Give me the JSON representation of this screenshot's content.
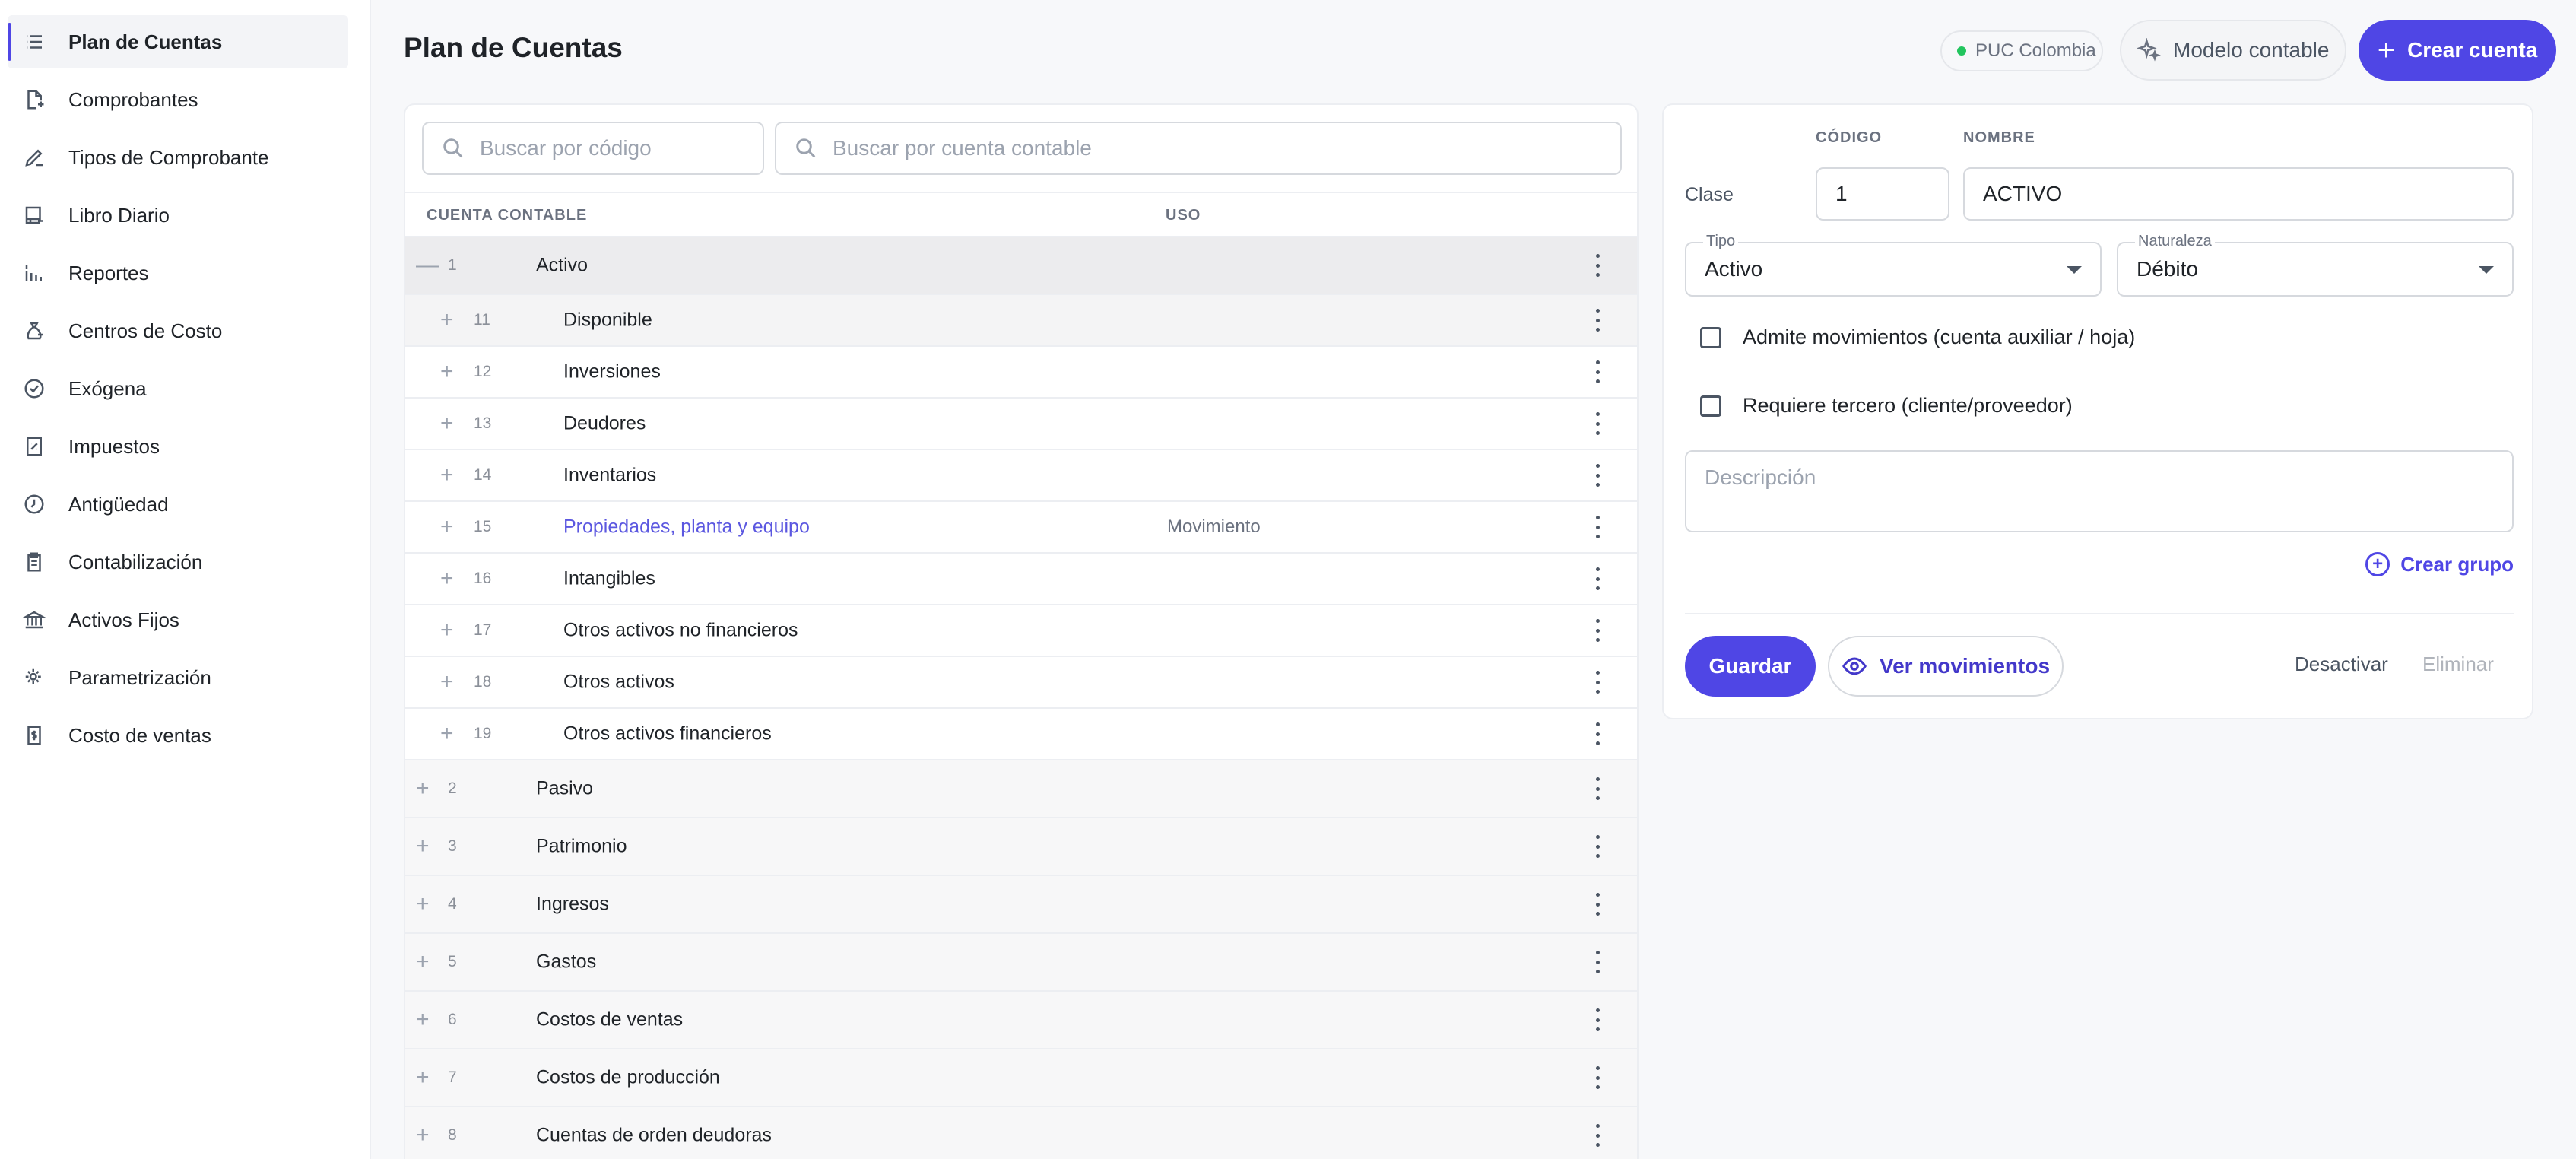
{
  "sidebar": {
    "items": [
      {
        "label": "Plan de Cuentas",
        "icon": "list-icon"
      },
      {
        "label": "Comprobantes",
        "icon": "document-icon"
      },
      {
        "label": "Tipos de Comprobante",
        "icon": "pen-icon"
      },
      {
        "label": "Libro Diario",
        "icon": "book-icon"
      },
      {
        "label": "Reportes",
        "icon": "bar-chart-icon"
      },
      {
        "label": "Centros de Costo",
        "icon": "money-bag-icon"
      },
      {
        "label": "Exógena",
        "icon": "check-circle-icon"
      },
      {
        "label": "Impuestos",
        "icon": "receipt-percent-icon"
      },
      {
        "label": "Antigüedad",
        "icon": "clock-icon"
      },
      {
        "label": "Contabilización",
        "icon": "clipboard-icon"
      },
      {
        "label": "Activos Fijos",
        "icon": "bank-icon"
      },
      {
        "label": "Parametrización",
        "icon": "settings-icon"
      },
      {
        "label": "Costo de ventas",
        "icon": "receipt-dollar-icon"
      }
    ]
  },
  "header": {
    "title": "Plan de Cuentas",
    "puc_badge": "PUC Colombia",
    "modelo_label": "Modelo contable",
    "crear_cuenta_label": "Crear cuenta"
  },
  "tree": {
    "search_code_placeholder": "Buscar por código",
    "search_account_placeholder": "Buscar por cuenta contable",
    "col_cuenta": "CUENTA CONTABLE",
    "col_uso": "USO",
    "rows": [
      {
        "level": 1,
        "toggle": "—",
        "code": "1",
        "name": "Activo",
        "uso": ""
      },
      {
        "level": 2,
        "toggle": "+",
        "code": "11",
        "name": "Disponible",
        "uso": ""
      },
      {
        "level": 2,
        "toggle": "+",
        "code": "12",
        "name": "Inversiones",
        "uso": ""
      },
      {
        "level": 2,
        "toggle": "+",
        "code": "13",
        "name": "Deudores",
        "uso": ""
      },
      {
        "level": 2,
        "toggle": "+",
        "code": "14",
        "name": "Inventarios",
        "uso": ""
      },
      {
        "level": 2,
        "toggle": "+",
        "code": "15",
        "name": "Propiedades, planta y equipo",
        "uso": "Movimiento"
      },
      {
        "level": 2,
        "toggle": "+",
        "code": "16",
        "name": "Intangibles",
        "uso": ""
      },
      {
        "level": 2,
        "toggle": "+",
        "code": "17",
        "name": "Otros activos no financieros",
        "uso": ""
      },
      {
        "level": 2,
        "toggle": "+",
        "code": "18",
        "name": "Otros activos",
        "uso": ""
      },
      {
        "level": 2,
        "toggle": "+",
        "code": "19",
        "name": "Otros activos financieros",
        "uso": ""
      },
      {
        "level": 1,
        "toggle": "+",
        "code": "2",
        "name": "Pasivo",
        "uso": ""
      },
      {
        "level": 1,
        "toggle": "+",
        "code": "3",
        "name": "Patrimonio",
        "uso": ""
      },
      {
        "level": 1,
        "toggle": "+",
        "code": "4",
        "name": "Ingresos",
        "uso": ""
      },
      {
        "level": 1,
        "toggle": "+",
        "code": "5",
        "name": "Gastos",
        "uso": ""
      },
      {
        "level": 1,
        "toggle": "+",
        "code": "6",
        "name": "Costos de ventas",
        "uso": ""
      },
      {
        "level": 1,
        "toggle": "+",
        "code": "7",
        "name": "Costos de producción",
        "uso": ""
      },
      {
        "level": 1,
        "toggle": "+",
        "code": "8",
        "name": "Cuentas de orden deudoras",
        "uso": ""
      }
    ]
  },
  "form": {
    "col_codigo": "CÓDIGO",
    "col_nombre": "NOMBRE",
    "clase_label": "Clase",
    "codigo_value": "1",
    "nombre_value": "ACTIVO",
    "tipo_label": "Tipo",
    "tipo_value": "Activo",
    "naturaleza_label": "Naturaleza",
    "naturaleza_value": "Débito",
    "admite_label": "Admite movimientos (cuenta auxiliar / hoja)",
    "requiere_label": "Requiere tercero (cliente/proveedor)",
    "descripcion_placeholder": "Descripción",
    "crear_grupo_label": "Crear grupo",
    "guardar_label": "Guardar",
    "ver_movimientos_label": "Ver movimientos",
    "desactivar_label": "Desactivar",
    "eliminar_label": "Eliminar"
  },
  "colors": {
    "accent": "#4f46e5",
    "status_dot": "#22c55e",
    "link": "#5b57e0"
  }
}
